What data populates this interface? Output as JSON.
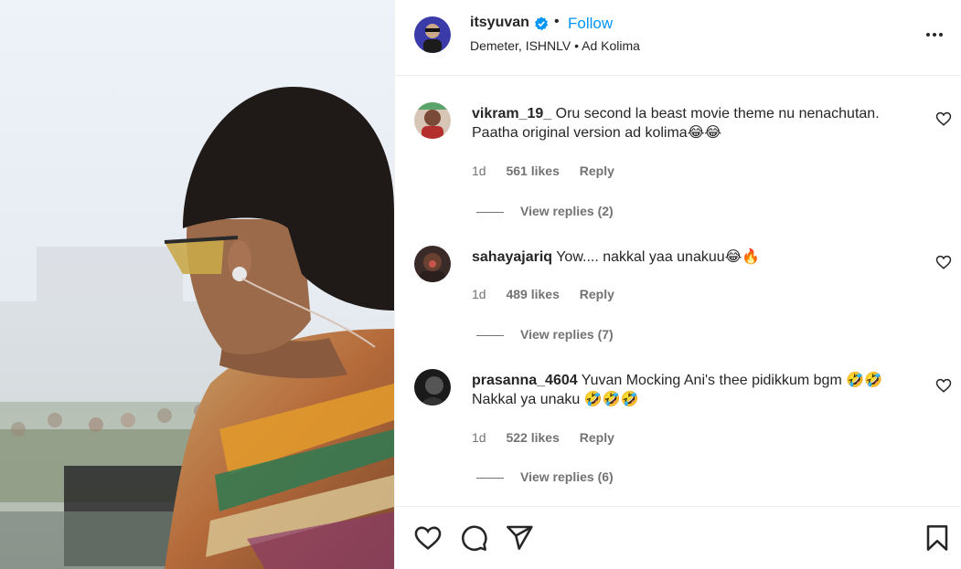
{
  "post": {
    "username": "itsyuvan",
    "follow_label": "Follow",
    "separator": "•",
    "location": "Demeter, ISHNLV • Ad Kolima"
  },
  "comments": [
    {
      "username": "vikram_19_",
      "text": "Oru second la beast movie theme nu nenachutan. Paatha original version ad kolima😂😂",
      "age": "1d",
      "likes": "561 likes",
      "reply_label": "Reply",
      "view_replies": "View replies (2)"
    },
    {
      "username": "sahayajariq",
      "text": "Yow.... nakkal yaa unakuu😂🔥",
      "age": "1d",
      "likes": "489 likes",
      "reply_label": "Reply",
      "view_replies": "View replies (7)"
    },
    {
      "username": "prasanna_4604",
      "text": "Yuvan Mocking Ani's thee pidikkum bgm 🤣🤣 Nakkal ya unaku 🤣🤣🤣",
      "age": "1d",
      "likes": "522 likes",
      "reply_label": "Reply",
      "view_replies": "View replies (6)"
    }
  ],
  "icons": {
    "verified": "verified-badge-icon",
    "more": "more-options-icon",
    "like": "heart-icon",
    "comment": "comment-icon",
    "share": "share-icon",
    "save": "bookmark-icon"
  },
  "colors": {
    "accent": "#0095f6",
    "text": "#262626",
    "muted": "#737373"
  }
}
